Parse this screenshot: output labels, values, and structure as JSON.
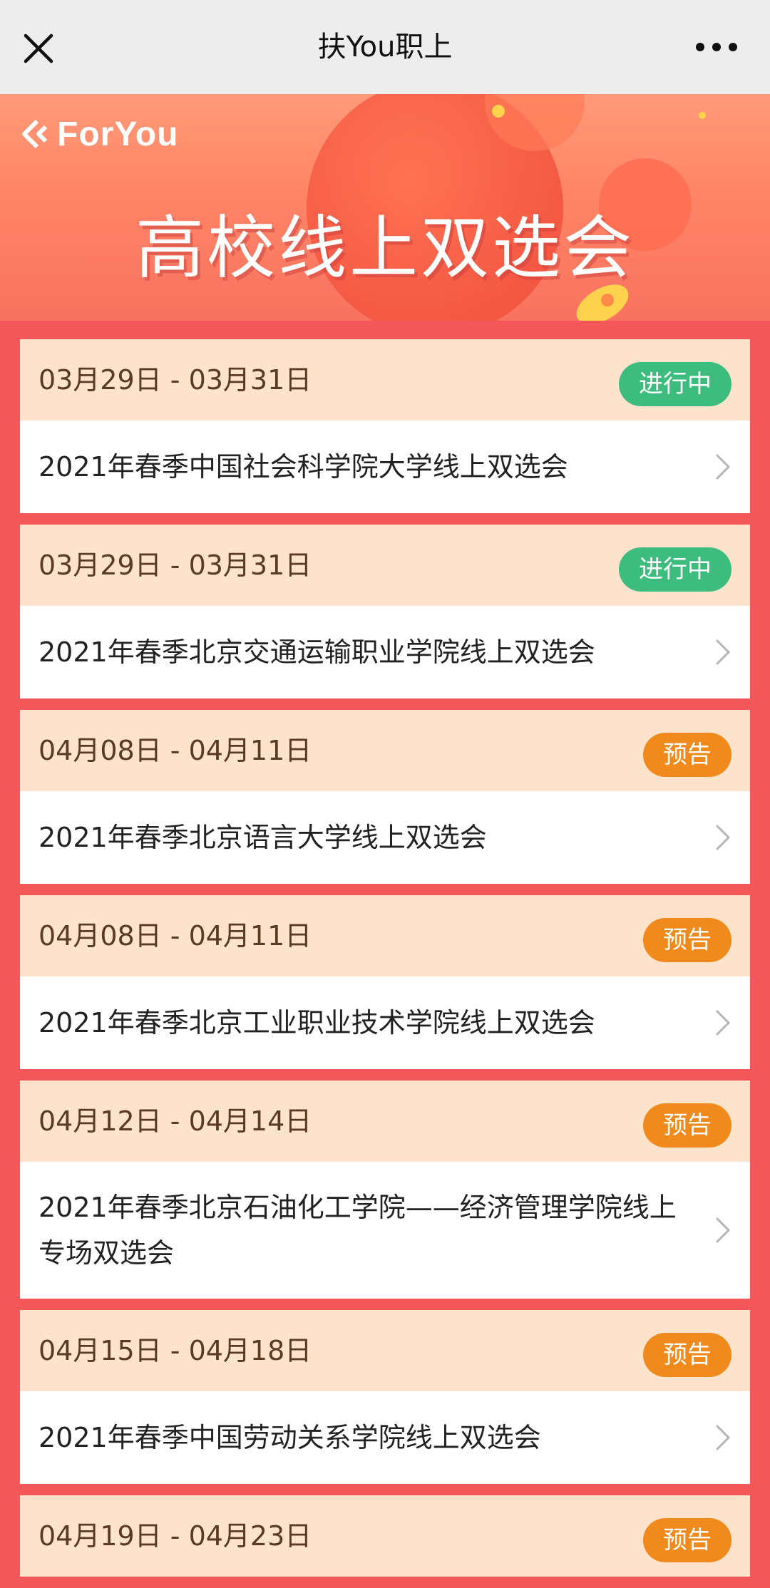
{
  "topbar": {
    "title": "扶You职上",
    "close_icon": "close-icon",
    "more_icon": "more-dots-icon"
  },
  "banner": {
    "logo_text": "ForYou",
    "title": "高校线上双选会"
  },
  "colors": {
    "page_bg": "#f4575a",
    "card_head": "#fde3cc",
    "badge_ongoing": "#3dbd7d",
    "badge_preview": "#f08a1d"
  },
  "events": [
    {
      "date": "03月29日 - 03月31日",
      "status": "进行中",
      "status_type": "ongoing",
      "title": "2021年春季中国社会科学院大学线上双选会"
    },
    {
      "date": "03月29日 - 03月31日",
      "status": "进行中",
      "status_type": "ongoing",
      "title": "2021年春季北京交通运输职业学院线上双选会"
    },
    {
      "date": "04月08日 - 04月11日",
      "status": "预告",
      "status_type": "preview",
      "title": "2021年春季北京语言大学线上双选会"
    },
    {
      "date": "04月08日 - 04月11日",
      "status": "预告",
      "status_type": "preview",
      "title": "2021年春季北京工业职业技术学院线上双选会"
    },
    {
      "date": "04月12日 - 04月14日",
      "status": "预告",
      "status_type": "preview",
      "title": "2021年春季北京石油化工学院——经济管理学院线上专场双选会"
    },
    {
      "date": "04月15日 - 04月18日",
      "status": "预告",
      "status_type": "preview",
      "title": "2021年春季中国劳动关系学院线上双选会"
    },
    {
      "date": "04月19日 - 04月23日",
      "status": "预告",
      "status_type": "preview",
      "title": ""
    }
  ]
}
